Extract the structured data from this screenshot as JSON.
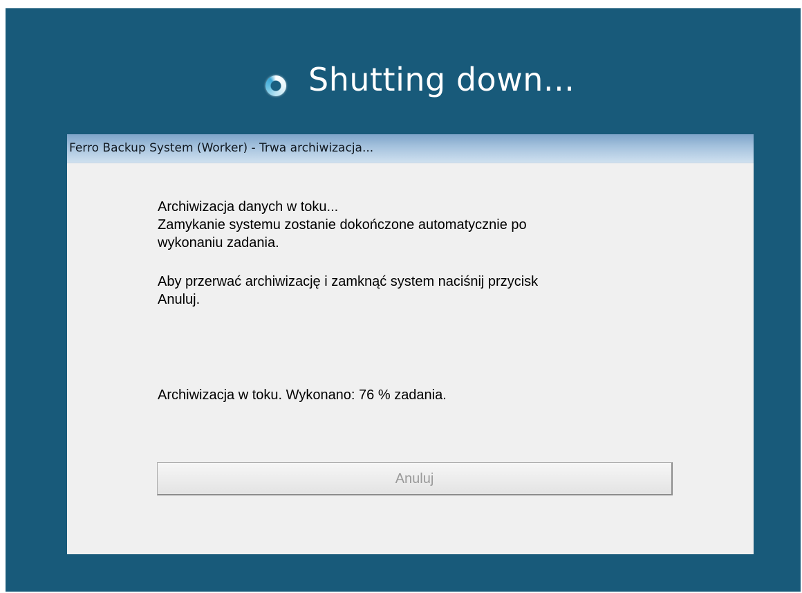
{
  "shutdown": {
    "icon": "spinner-icon",
    "text": "Shutting down..."
  },
  "dialog": {
    "title": "Ferro Backup System (Worker) - Trwa archiwizacja...",
    "message_line1": "Archiwizacja danych w toku...",
    "message_line2": "Zamykanie systemu zostanie dokończone automatycznie po",
    "message_line3": "wykonaniu zadania.",
    "instruction_line1": "Aby przerwać archiwizację i zamknąć system naciśnij przycisk",
    "instruction_line2": "Anuluj.",
    "progress_text": "Archiwizacja w toku. Wykonano: 76 % zadania.",
    "progress_percent": 76,
    "cancel_label": "Anuluj",
    "cancel_enabled": false
  },
  "colors": {
    "desktop_background": "#185a7a",
    "dialog_background": "#f0f0f0",
    "titlebar_gradient_top": "#7ea4c9",
    "disabled_text": "#9a9a9a"
  }
}
